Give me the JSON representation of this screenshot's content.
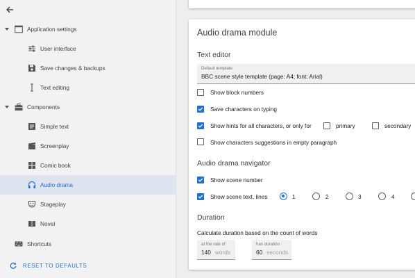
{
  "sidebar": {
    "groups": [
      {
        "label": "Application settings",
        "icon": "window-icon",
        "items": [
          {
            "label": "User interface",
            "icon": "sliders-icon"
          },
          {
            "label": "Save changes & backups",
            "icon": "floppy-disk-icon"
          },
          {
            "label": "Text editing",
            "icon": "text-cursor-icon"
          }
        ]
      },
      {
        "label": "Components",
        "icon": "toolbox-icon",
        "items": [
          {
            "label": "Simple text",
            "icon": "document-icon"
          },
          {
            "label": "Screenplay",
            "icon": "clapperboard-icon"
          },
          {
            "label": "Comic book",
            "icon": "grid-panels-icon"
          },
          {
            "label": "Audio drama",
            "icon": "headphones-icon",
            "selected": true
          },
          {
            "label": "Stageplay",
            "icon": "theater-mask-icon"
          },
          {
            "label": "Novel",
            "icon": "open-book-icon"
          }
        ]
      }
    ],
    "shortcuts": {
      "label": "Shortcuts",
      "icon": "keyboard-icon"
    },
    "reset": {
      "label": "RESET TO DEFAULTS",
      "icon": "refresh-icon"
    }
  },
  "module": {
    "title": "Audio drama module",
    "text_editor": {
      "heading": "Text editor",
      "template_label": "Default template",
      "template_value": "BBC scene style template (page: A4; font: Arial)",
      "show_block_numbers": {
        "label": "Show block numbers",
        "checked": false
      },
      "save_characters": {
        "label": "Save characters on typing",
        "checked": true
      },
      "show_hints": {
        "label": "Show hints for all characters, or only for",
        "checked": true
      },
      "hint_primary": {
        "label": "primary",
        "checked": false
      },
      "hint_secondary": {
        "label": "secondary",
        "checked": false
      },
      "show_suggestions": {
        "label": "Show characters suggestions in empty paragraph",
        "checked": false
      }
    },
    "navigator": {
      "heading": "Audio drama navigator",
      "show_scene_number": {
        "label": "Show scene number",
        "checked": true
      },
      "show_scene_text": {
        "label": "Show scene text, lines",
        "checked": true
      },
      "lines_options": [
        "1",
        "2",
        "3",
        "4"
      ],
      "lines_selected": "1"
    },
    "duration": {
      "heading": "Duration",
      "description": "Calculate duration based on the count of words",
      "rate_label": "at the rate of",
      "rate_value": "140",
      "rate_unit": "words",
      "has_duration_label": "has duration",
      "duration_value": "60",
      "duration_unit": "seconds"
    }
  },
  "colors": {
    "accent": "#1e6fd9",
    "selected_bg": "#dde4f0",
    "sidebar_bg": "#f2f2f2"
  }
}
